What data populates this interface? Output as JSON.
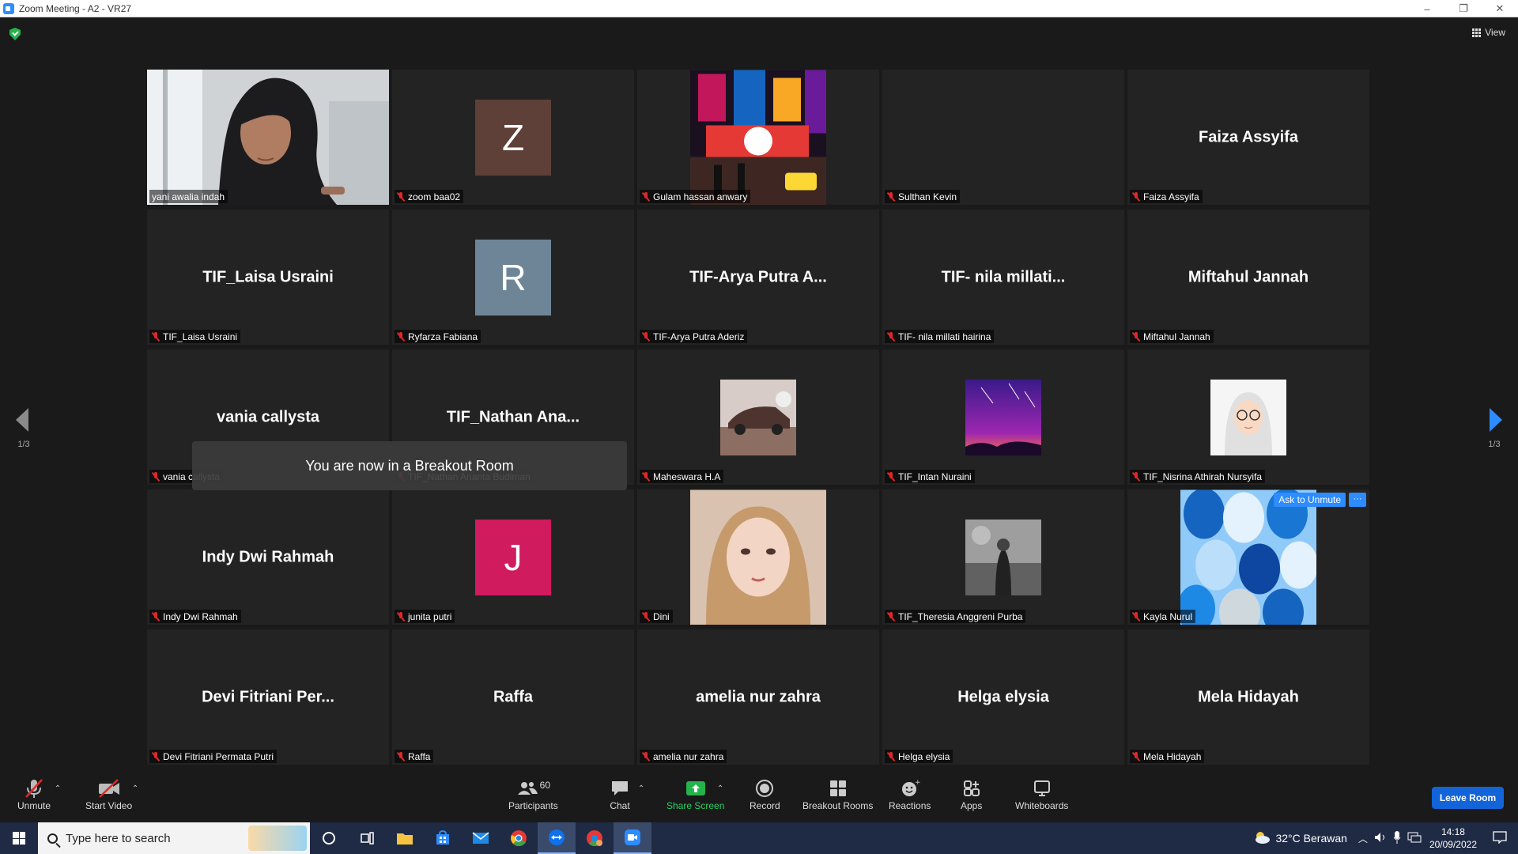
{
  "window": {
    "title": "Zoom Meeting - A2 - VR27",
    "controls": [
      "–",
      "❐",
      "✕"
    ]
  },
  "header": {
    "view_label": "View"
  },
  "pager": {
    "left": "1/3",
    "right": "1/3"
  },
  "participants": [
    {
      "display": "video",
      "label": "yani awalia indah",
      "active": true,
      "muted": false
    },
    {
      "display": "letter",
      "letter": "Z",
      "color": "#5e4038",
      "label": "zoom baa02",
      "muted": true
    },
    {
      "display": "photo",
      "photo": "city-night",
      "label": "Gulam hassan anwary",
      "muted": true
    },
    {
      "display": "blank",
      "label": "Sulthan Kevin",
      "muted": true
    },
    {
      "display": "name",
      "big_name": "Faiza Assyifa",
      "label": "Faiza Assyifa",
      "muted": true
    },
    {
      "display": "name",
      "big_name": "TIF_Laisa Usraini",
      "label": "TIF_Laisa Usraini",
      "muted": true
    },
    {
      "display": "letter",
      "letter": "R",
      "color": "#6e8597",
      "label": "Ryfarza Fabiana",
      "muted": true
    },
    {
      "display": "name",
      "big_name": "TIF-Arya Putra A...",
      "label": "TIF-Arya Putra Aderiz",
      "muted": true
    },
    {
      "display": "name",
      "big_name": "TIF- nila millati...",
      "label": "TIF- nila millati hairina",
      "muted": true
    },
    {
      "display": "name",
      "big_name": "Miftahul Jannah",
      "label": "Miftahul Jannah",
      "muted": true
    },
    {
      "display": "name",
      "big_name": "vania callysta",
      "label": "vania callysta",
      "muted": true
    },
    {
      "display": "name",
      "big_name": "TIF_Nathan  Ana...",
      "label": "TIF_Nathan Ananta Budiman",
      "muted": true
    },
    {
      "display": "photo",
      "photo": "car-photo",
      "label": "Maheswara H.A",
      "muted": true
    },
    {
      "display": "photo",
      "photo": "purple-sky",
      "label": "TIF_Intan Nuraini",
      "muted": true
    },
    {
      "display": "photo",
      "photo": "hijab-cartoon",
      "label": "TIF_Nisrina Athirah Nursyifa",
      "muted": true
    },
    {
      "display": "name",
      "big_name": "Indy Dwi Rahmah",
      "label": "Indy Dwi Rahmah",
      "muted": true
    },
    {
      "display": "letter",
      "letter": "J",
      "color": "#d01b5e",
      "label": "junita putri",
      "muted": true
    },
    {
      "display": "photo",
      "photo": "selfie",
      "label": "Dini",
      "muted": true
    },
    {
      "display": "photo",
      "photo": "bw-portrait",
      "label": "TIF_Theresia Anggreni Purba",
      "muted": true
    },
    {
      "display": "photo",
      "photo": "balloons",
      "label": "Kayla Nurul",
      "muted": true,
      "hover": true
    },
    {
      "display": "name",
      "big_name": "Devi Fitriani Per...",
      "label": "Devi Fitriani Permata Putri",
      "muted": true
    },
    {
      "display": "name",
      "big_name": "Raffa",
      "label": "Raffa",
      "muted": true
    },
    {
      "display": "name",
      "big_name": "amelia nur zahra",
      "label": "amelia nur zahra",
      "muted": true
    },
    {
      "display": "name",
      "big_name": "Helga elysia",
      "label": "Helga elysia",
      "muted": true
    },
    {
      "display": "name",
      "big_name": "Mela Hidayah",
      "label": "Mela Hidayah",
      "muted": true
    }
  ],
  "hover_actions": {
    "ask_unmute": "Ask to Unmute",
    "more": "···"
  },
  "toast": "You are now in a Breakout Room",
  "toolbar": {
    "unmute": "Unmute",
    "start_video": "Start Video",
    "participants": "Participants",
    "participants_count": "60",
    "chat": "Chat",
    "share_screen": "Share Screen",
    "record": "Record",
    "breakout_rooms": "Breakout Rooms",
    "reactions": "Reactions",
    "apps": "Apps",
    "whiteboards": "Whiteboards",
    "leave": "Leave Room"
  },
  "taskbar": {
    "search_placeholder": "Type here to search",
    "weather": "32°C  Berawan",
    "time": "14:18",
    "date": "20/09/2022"
  }
}
